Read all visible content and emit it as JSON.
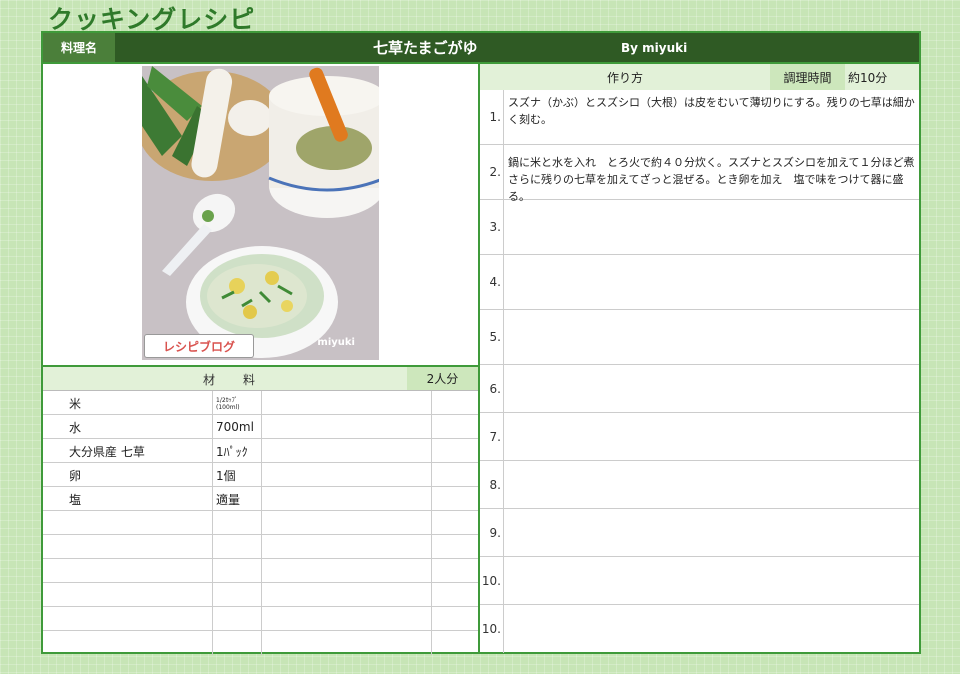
{
  "page": {
    "title": "クッキングレシピ"
  },
  "header": {
    "label": "料理名",
    "dish_name": "七草たまごがゆ",
    "author": "By  miyuki"
  },
  "photo": {
    "logo_text": "レシピブログ",
    "credit": "miyuki"
  },
  "ingredients": {
    "title": "材　料",
    "servings": "2人分",
    "rows": [
      {
        "name": "米",
        "qty": "1/2ｶｯﾌﾟ(100ml)"
      },
      {
        "name": "水",
        "qty": "700ml"
      },
      {
        "name": "大分県産  七草",
        "qty": "1ﾊﾟｯｸ"
      },
      {
        "name": "卵",
        "qty": "1個"
      },
      {
        "name": "塩",
        "qty": "適量"
      },
      {
        "name": "",
        "qty": ""
      },
      {
        "name": "",
        "qty": ""
      },
      {
        "name": "",
        "qty": ""
      },
      {
        "name": "",
        "qty": ""
      },
      {
        "name": "",
        "qty": ""
      },
      {
        "name": "",
        "qty": ""
      }
    ]
  },
  "steps": {
    "title": "作り方",
    "time_label": "調理時間",
    "time_value": "約10分",
    "items": [
      {
        "num": "1.",
        "text": "スズナ（かぶ）とスズシロ（大根）は皮をむいて薄切りにする。残りの七草は細かく刻む。"
      },
      {
        "num": "2.",
        "text": "鍋に米と水を入れ　とろ火で約４０分炊く。スズナとスズシロを加えて１分ほど煮さらに残りの七草を加えてざっと混ぜる。とき卵を加え　塩で味をつけて器に盛る。"
      },
      {
        "num": "3.",
        "text": ""
      },
      {
        "num": "4.",
        "text": ""
      },
      {
        "num": "5.",
        "text": ""
      },
      {
        "num": "6.",
        "text": ""
      },
      {
        "num": "7.",
        "text": ""
      },
      {
        "num": "8.",
        "text": ""
      },
      {
        "num": "9.",
        "text": ""
      },
      {
        "num": "10.",
        "text": ""
      },
      {
        "num": "10.",
        "text": ""
      }
    ]
  }
}
